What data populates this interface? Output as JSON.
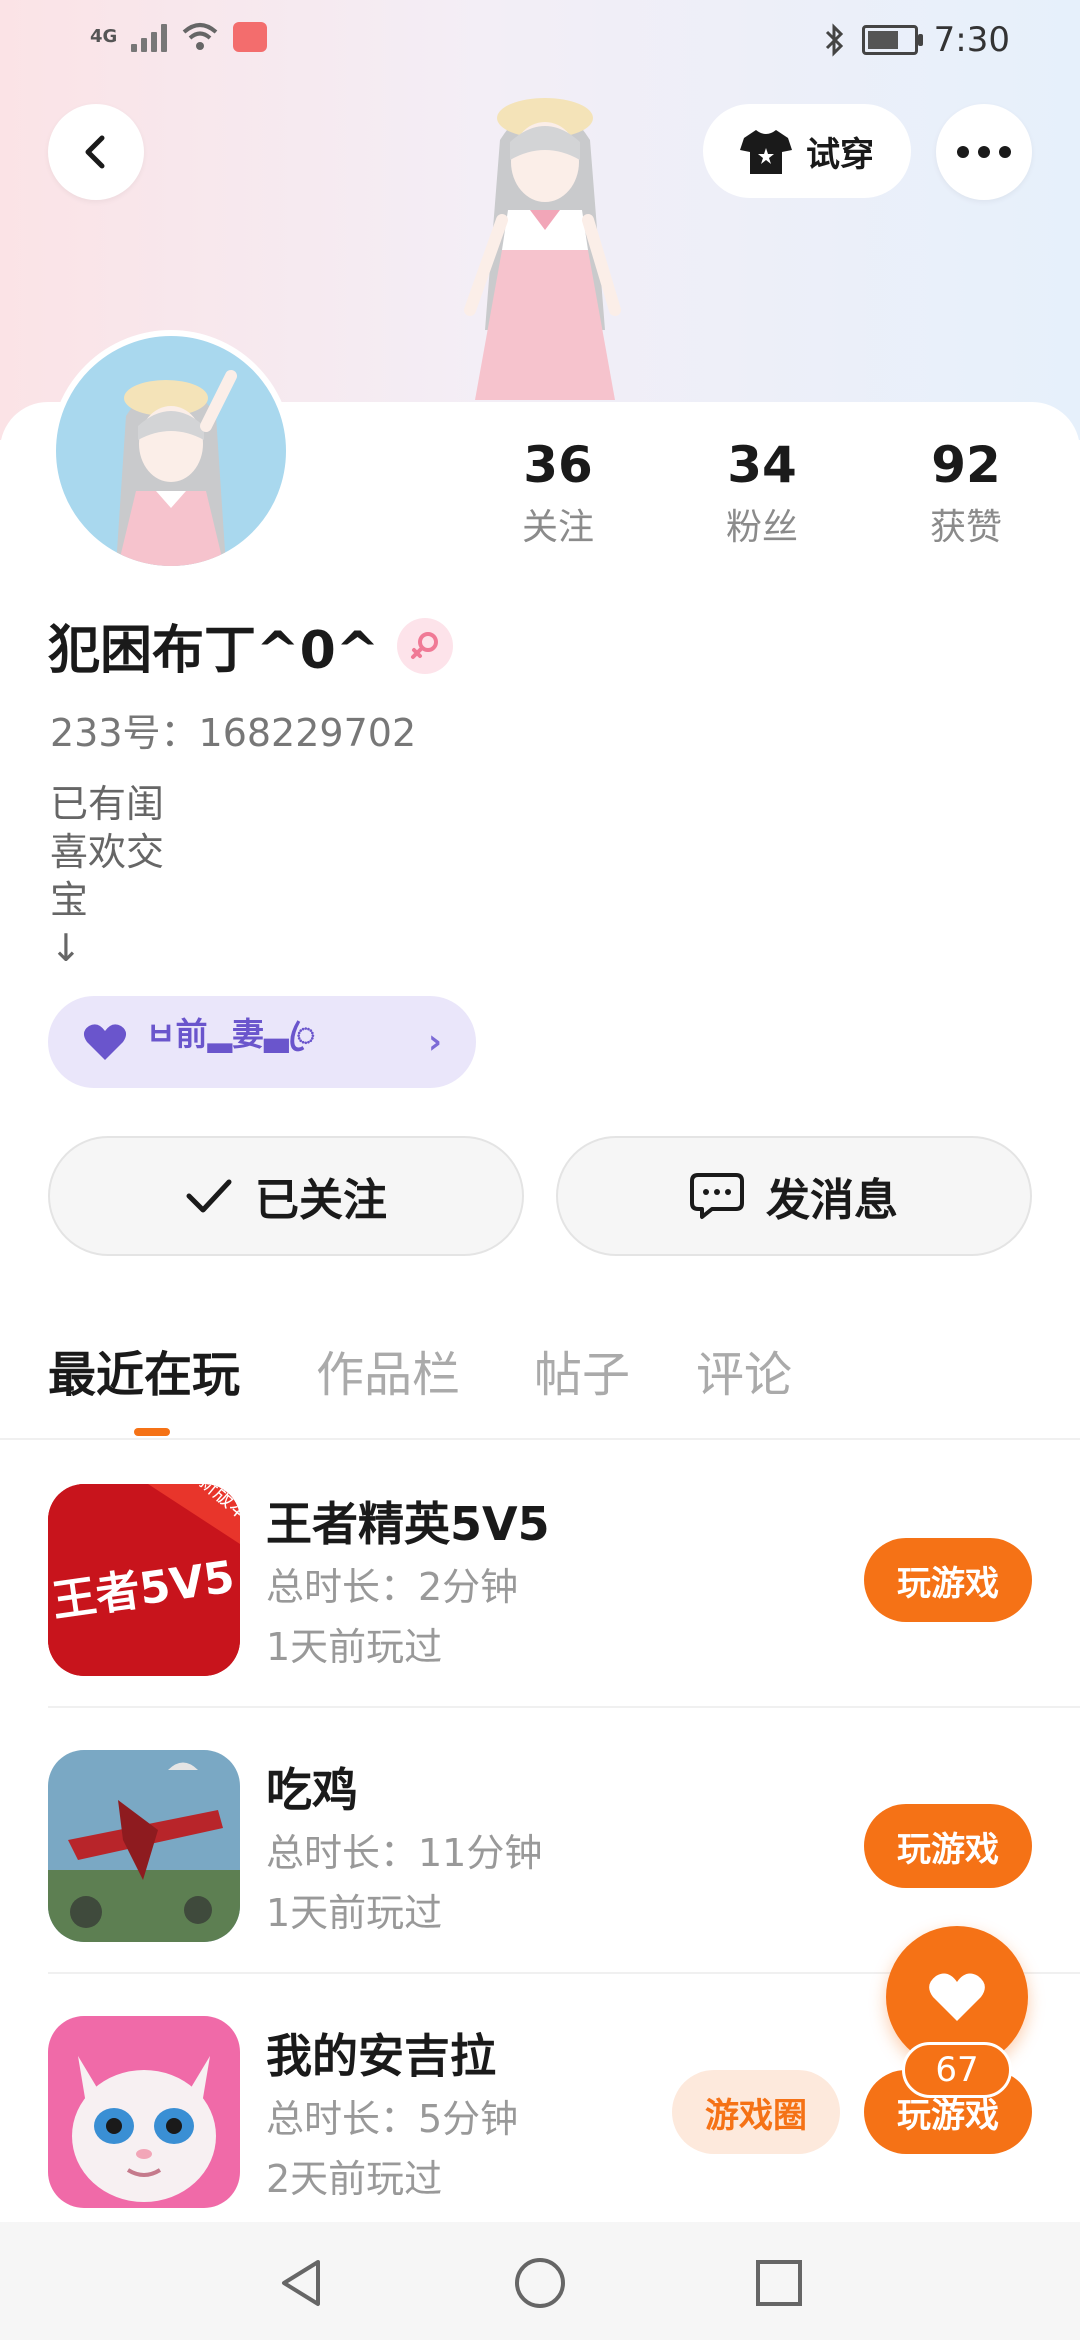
{
  "status_bar": {
    "network": "4G",
    "time": "7:30"
  },
  "header": {
    "try_on_label": "试穿"
  },
  "profile": {
    "stats": [
      {
        "value": "36",
        "label": "关注"
      },
      {
        "value": "34",
        "label": "粉丝"
      },
      {
        "value": "92",
        "label": "获赞"
      }
    ],
    "name": "犯困布丁^0^",
    "gender": "female",
    "uid": "233号：168229702",
    "bio_lines": [
      "已有闺",
      "喜欢交",
      "宝",
      "↓"
    ],
    "couple_tag": "ㅂ前▂妻▃ꦿ"
  },
  "actions": {
    "follow_label": "已关注",
    "message_label": "发消息"
  },
  "tabs": [
    {
      "label": "最近在玩",
      "active": true
    },
    {
      "label": "作品栏",
      "active": false
    },
    {
      "label": "帖子",
      "active": false
    },
    {
      "label": "评论",
      "active": false
    }
  ],
  "games": [
    {
      "title": "王者精英5V5",
      "duration": "总时长：2分钟",
      "last_played": "1天前玩过",
      "play_label": "玩游戏",
      "icon": "wangzhe-5v5-icon",
      "icon_text": "王者5V5",
      "badge": "新版本"
    },
    {
      "title": "吃鸡",
      "duration": "总时长：11分钟",
      "last_played": "1天前玩过",
      "play_label": "玩游戏",
      "icon": "chiji-icon"
    },
    {
      "title": "我的安吉拉",
      "duration": "总时长：5分钟",
      "last_played": "2天前玩过",
      "play_label": "玩游戏",
      "circle_label": "游戏圈",
      "icon": "angela-icon"
    }
  ],
  "like_fab": {
    "count": "67"
  },
  "colors": {
    "accent": "#f57216",
    "couple_bg": "#eae6fa",
    "couple_text": "#6a55cc"
  }
}
